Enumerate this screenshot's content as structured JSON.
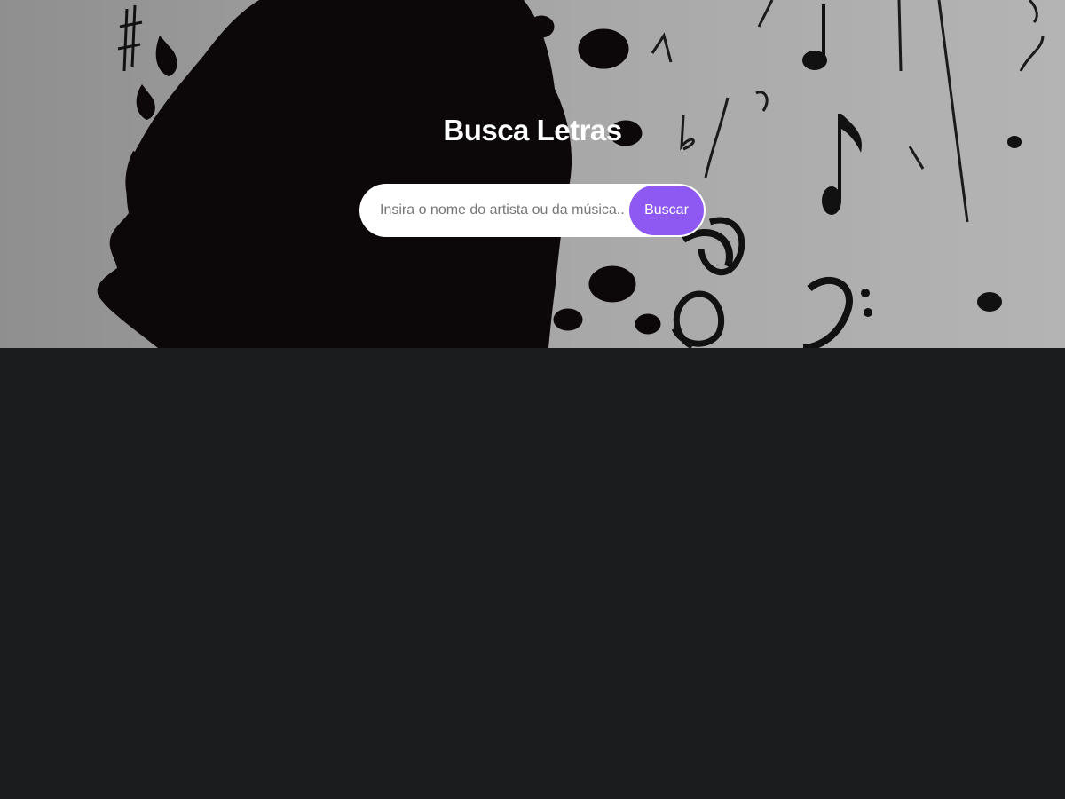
{
  "header": {
    "title": "Busca Letras"
  },
  "search": {
    "placeholder": "Insira o nome do artista ou da música...",
    "value": "",
    "button_label": "Buscar"
  },
  "colors": {
    "accent": "#8e59f2",
    "page_background": "#1b1c1e",
    "hero_background": "#9a9a9a",
    "silhouette": "#0c0709"
  },
  "icons": [
    "music-note-icon",
    "treble-clef-icon",
    "bass-clef-icon",
    "sharp-icon",
    "flat-icon"
  ]
}
